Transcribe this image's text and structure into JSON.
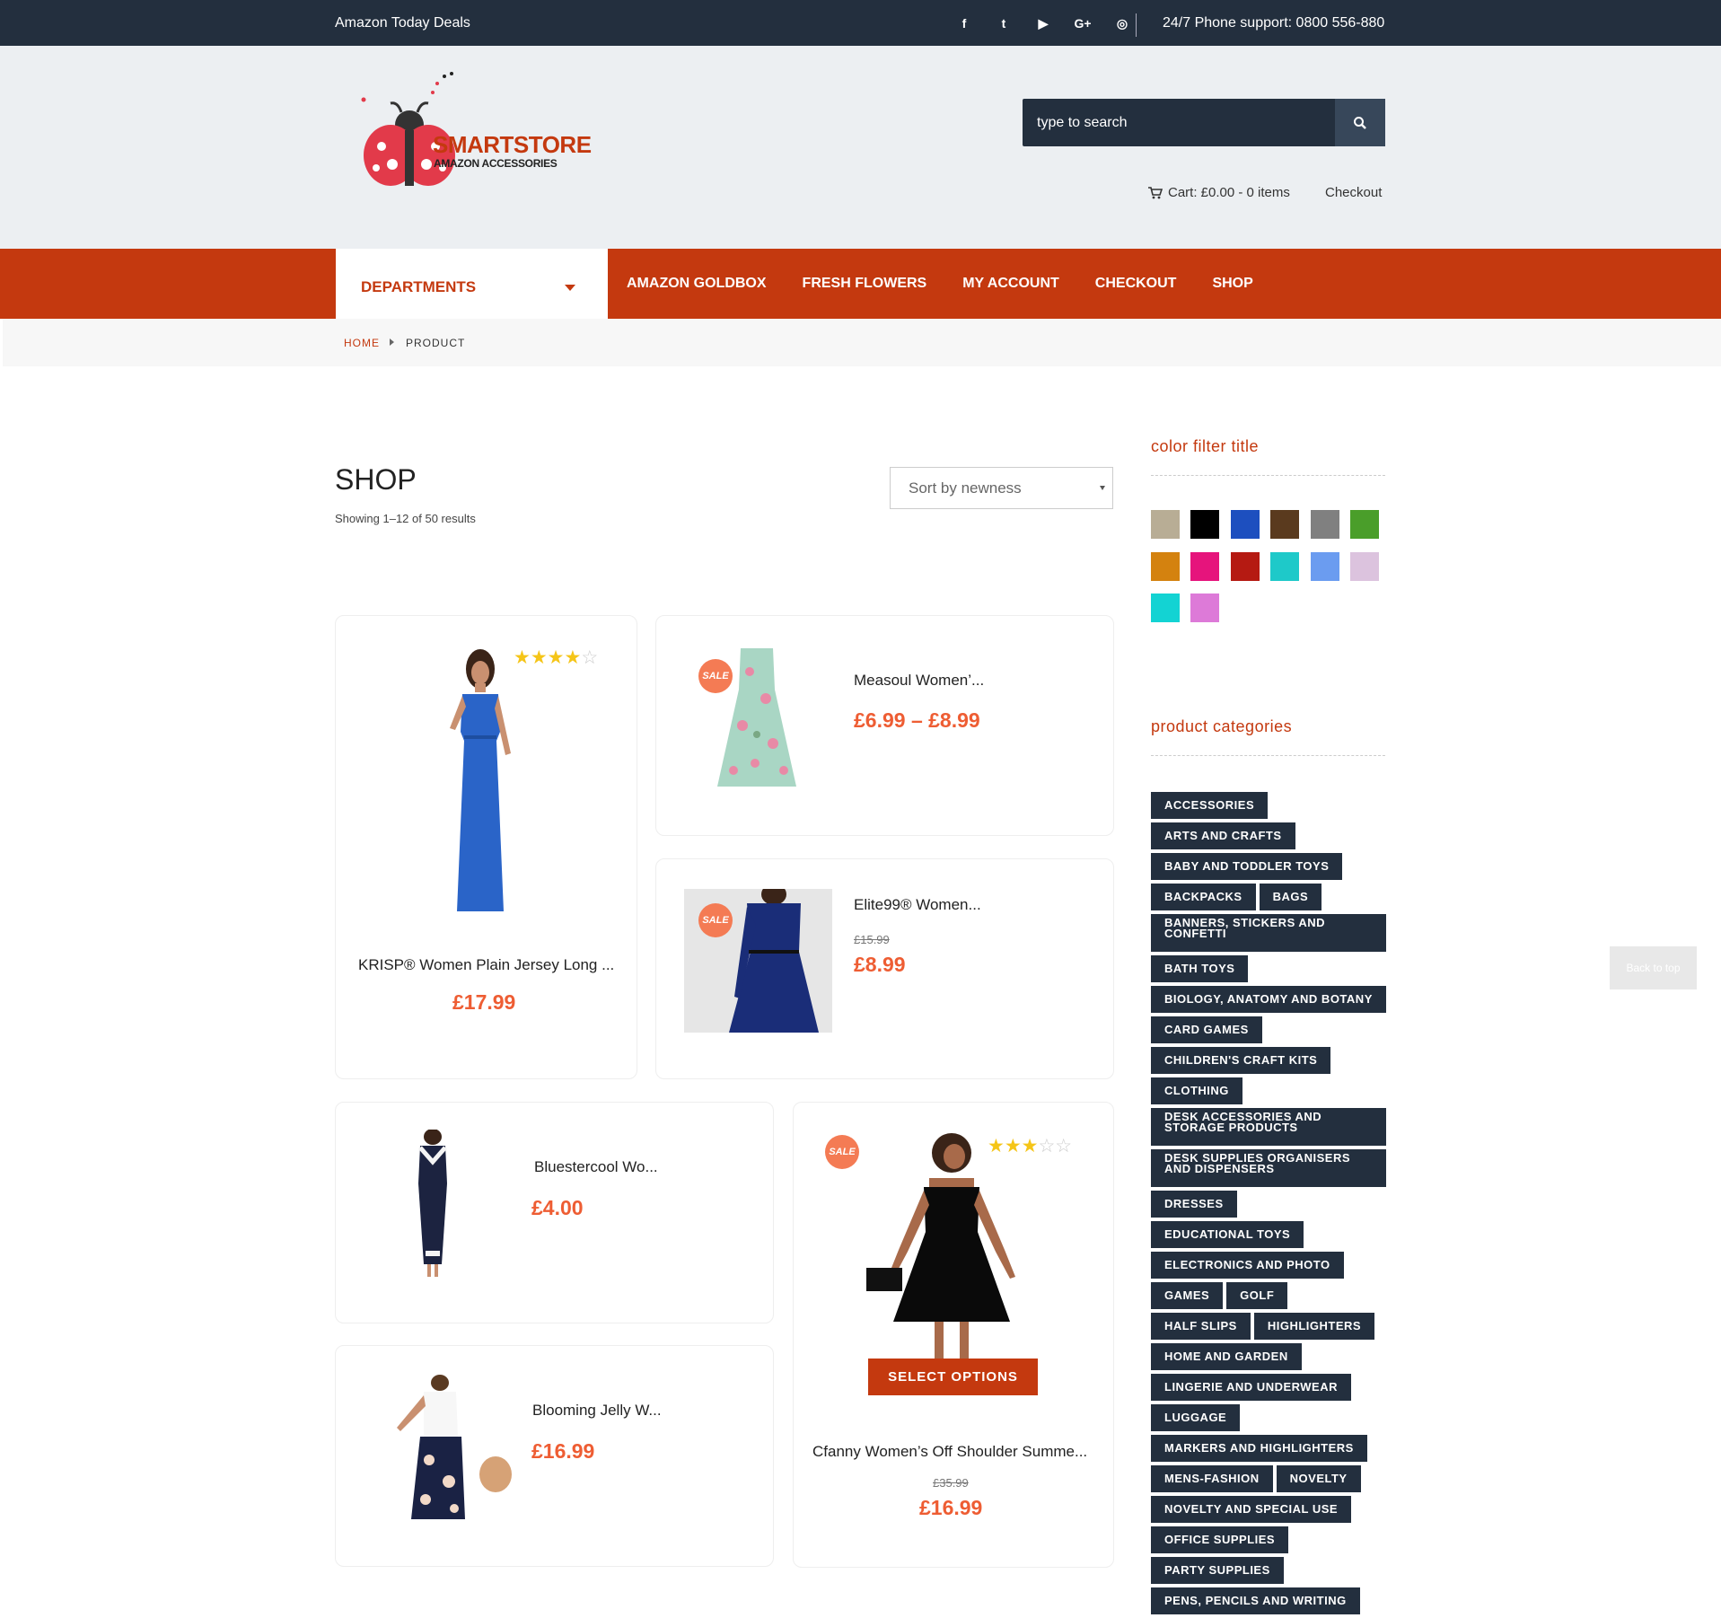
{
  "topbar": {
    "deals": "Amazon Today Deals",
    "socials": [
      "f",
      "t",
      "▶",
      "G+",
      "◎"
    ],
    "phone": "24/7 Phone support: 0800 556-880"
  },
  "logo": {
    "name": "SMARTSTORE",
    "tagline": "AMAZON ACCESSORIES"
  },
  "search": {
    "placeholder": "type to search"
  },
  "header": {
    "cart": "Cart: £0.00 - 0 items",
    "checkout": "Checkout"
  },
  "nav": {
    "departments": "DEPARTMENTS",
    "links": [
      "AMAZON GOLDBOX",
      "FRESH FLOWERS",
      "MY ACCOUNT",
      "CHECKOUT",
      "SHOP"
    ]
  },
  "breadcrumb": {
    "home": "HOME",
    "current": "PRODUCT"
  },
  "shop": {
    "title": "SHOP",
    "results": "Showing 1–12 of 50 results",
    "sort": "Sort by newness"
  },
  "products": [
    {
      "name": "KRISP® Women Plain Jersey Long ...",
      "price": "£17.99",
      "rating": 4
    },
    {
      "name": "Measoul Women’...",
      "price": "£6.99 – £8.99",
      "badge": "SALE"
    },
    {
      "name": "Elite99® Women...",
      "old_price": "£15.99",
      "price": "£8.99",
      "badge": "SALE"
    },
    {
      "name": "Bluestercool Wo...",
      "price": "£4.00"
    },
    {
      "name": "Cfanny Women’s Off Shoulder Summe...",
      "old_price": "£35.99",
      "price": "£16.99",
      "badge": "SALE",
      "rating": 3,
      "button": "SELECT OPTIONS"
    },
    {
      "name": "Blooming Jelly W...",
      "price": "£16.99"
    }
  ],
  "sidebar": {
    "color_title": "color filter title",
    "colors": [
      "#b8ad95",
      "#000000",
      "#1d4fbf",
      "#5a3a1e",
      "#808080",
      "#4a9e2a",
      "#d4820f",
      "#e6147c",
      "#b51a12",
      "#1ec9c9",
      "#6b9cf0",
      "#dcc3de",
      "#13d3d3",
      "#dd7ad8"
    ],
    "categories_title": "product categories",
    "categories": [
      "ACCESSORIES",
      "ARTS AND CRAFTS",
      "BABY AND TODDLER TOYS",
      "BACKPACKS",
      "BAGS",
      "BANNERS, STICKERS AND CONFETTI",
      "BATH TOYS",
      "BIOLOGY, ANATOMY AND BOTANY",
      "CARD GAMES",
      "CHILDREN'S CRAFT KITS",
      "CLOTHING",
      "DESK ACCESSORIES AND STORAGE PRODUCTS",
      "DESK SUPPLIES ORGANISERS AND DISPENSERS",
      "DRESSES",
      "EDUCATIONAL TOYS",
      "ELECTRONICS AND PHOTO",
      "GAMES",
      "GOLF",
      "HALF SLIPS",
      "HIGHLIGHTERS",
      "HOME AND GARDEN",
      "LINGERIE AND UNDERWEAR",
      "LUGGAGE",
      "MARKERS AND HIGHLIGHTERS",
      "MENS-FASHION",
      "NOVELTY",
      "NOVELTY AND SPECIAL USE",
      "OFFICE SUPPLIES",
      "PARTY SUPPLIES",
      "PENS, PENCILS AND WRITING"
    ]
  },
  "back_to_top": "Back to top"
}
